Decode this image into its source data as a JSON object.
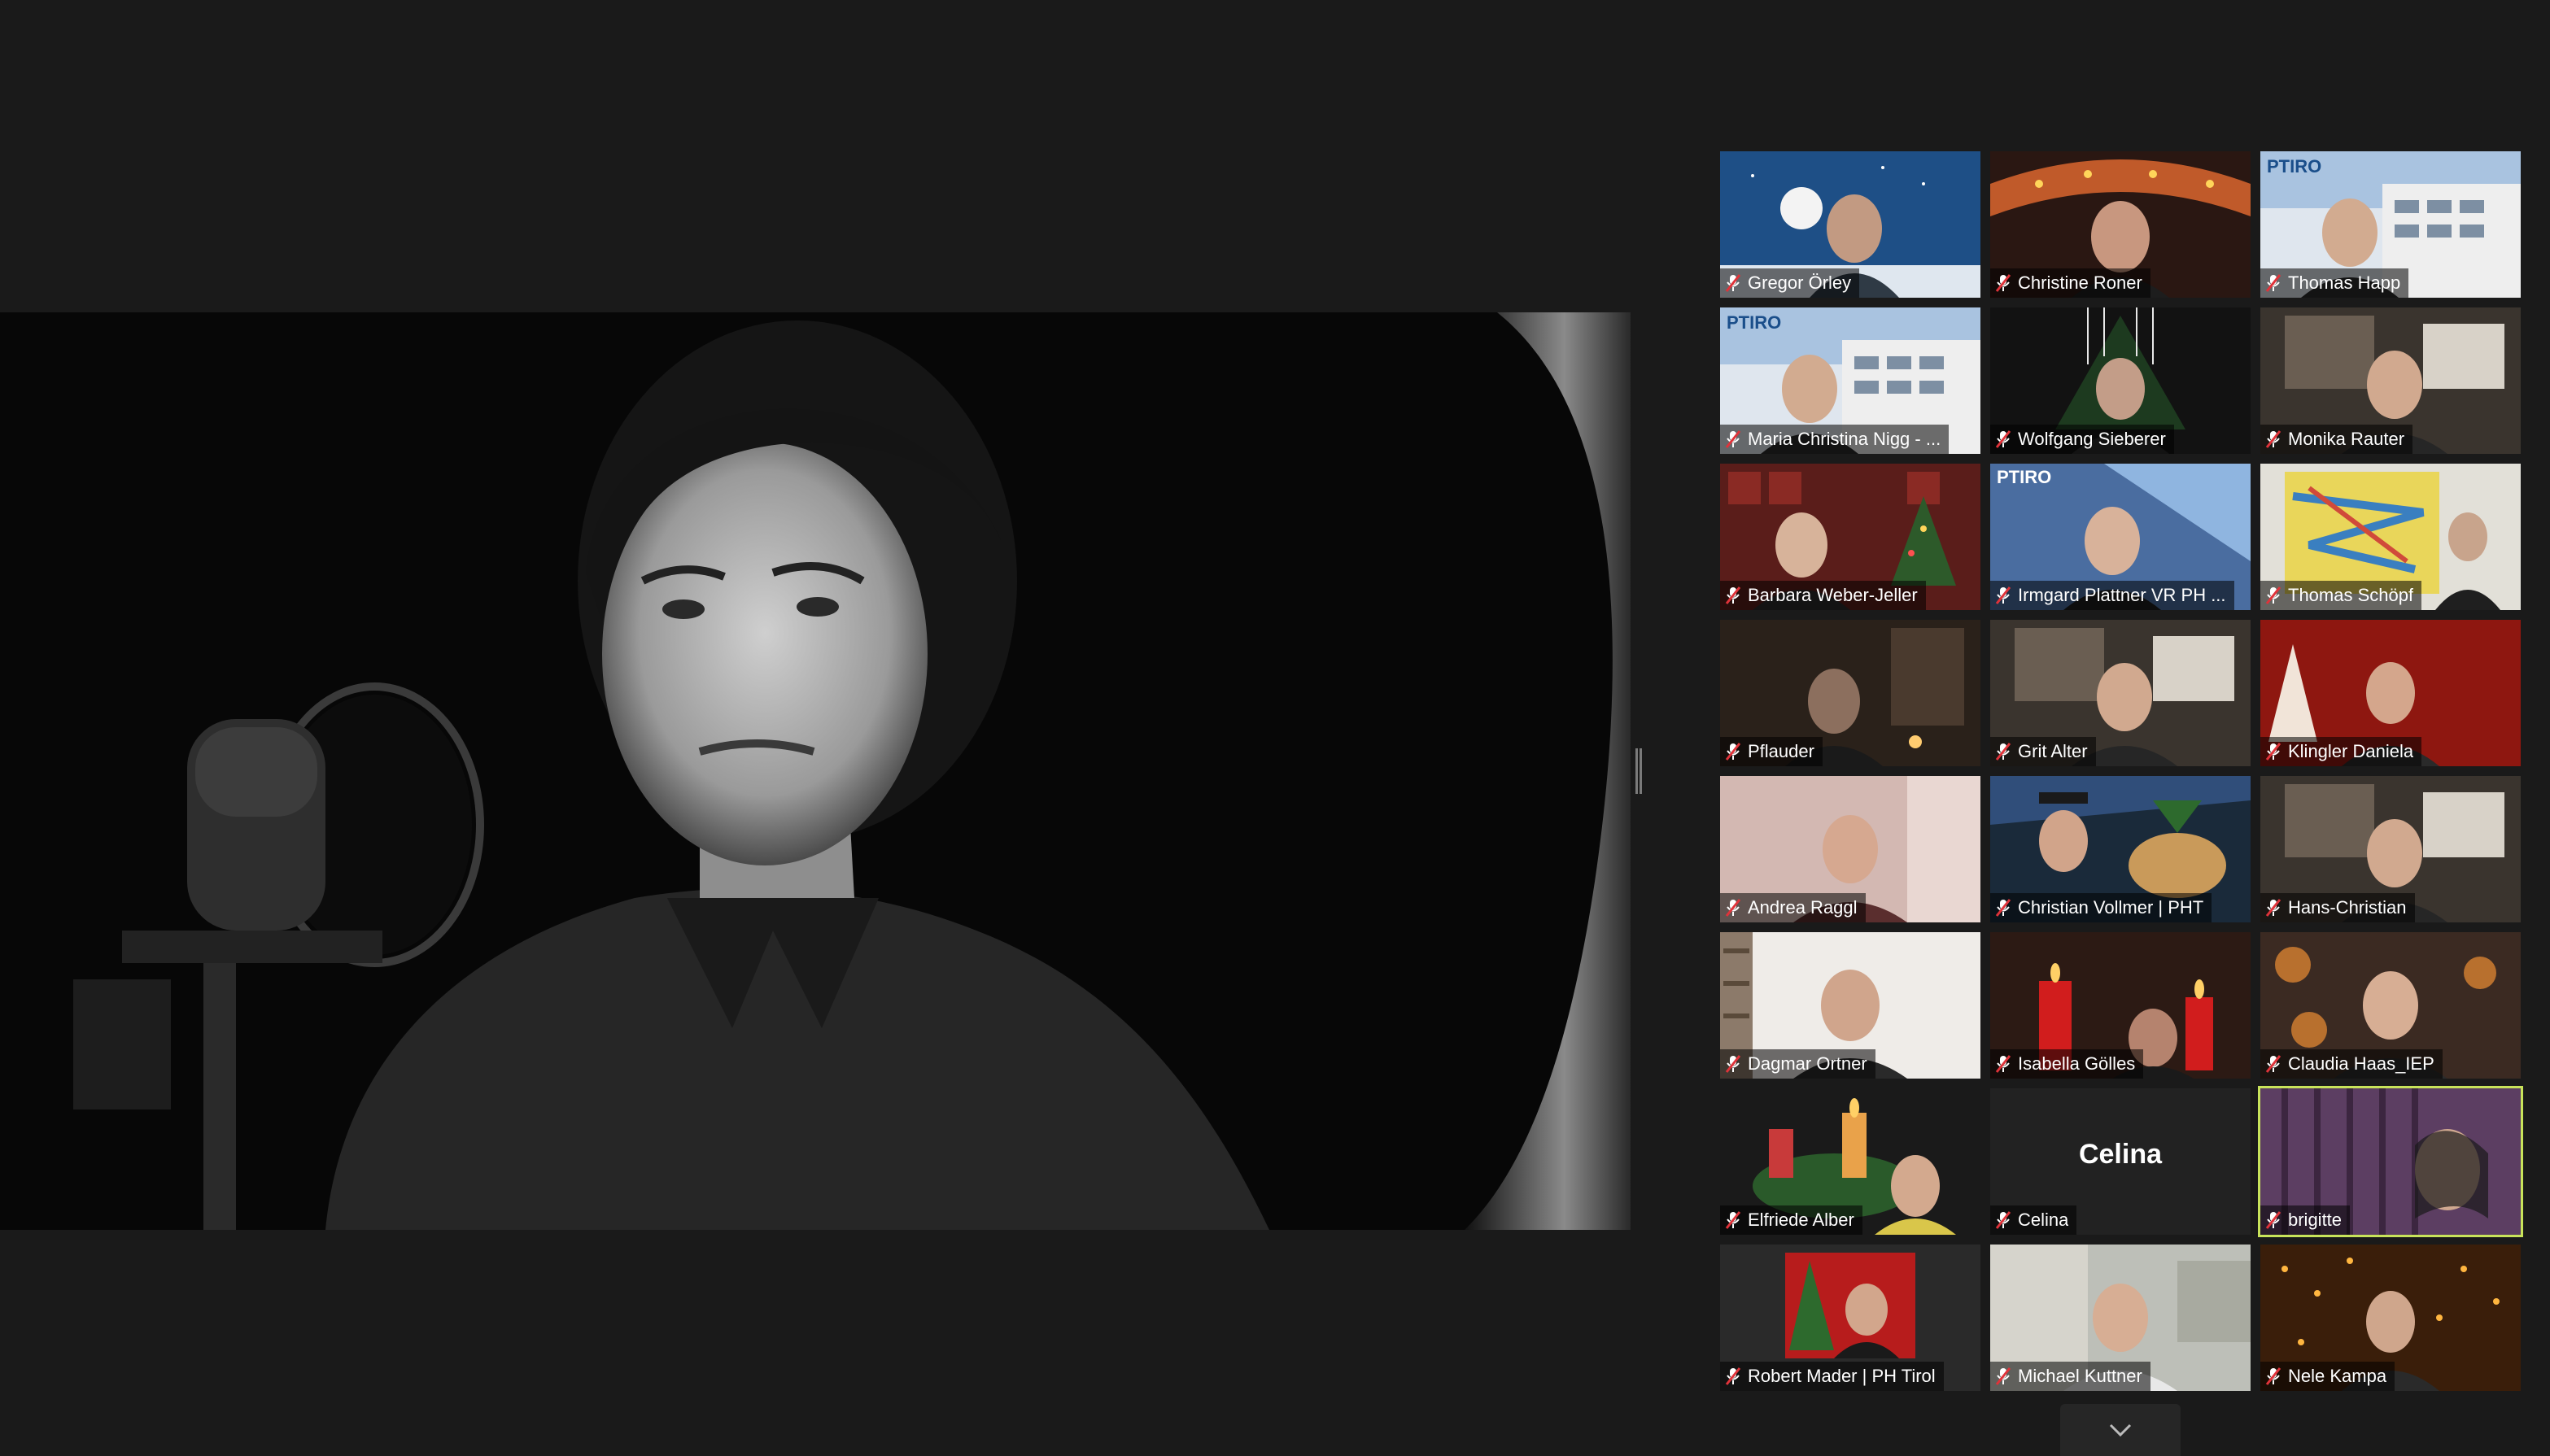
{
  "window": {
    "app": "Zoom Meeting",
    "accent_active_speaker": "#c8e35a",
    "muted_color": "#e0333a"
  },
  "main": {
    "shared_video_description_icon": "shared-video-icon"
  },
  "participants": [
    {
      "name": "Gregor Örley",
      "muted": true,
      "scene": "night-sky"
    },
    {
      "name": "Christine Roner",
      "muted": true,
      "scene": "carousel"
    },
    {
      "name": "Thomas Happ",
      "muted": true,
      "scene": "pht-building"
    },
    {
      "name": "Maria Christina Nigg  - ...",
      "muted": true,
      "scene": "pht-building"
    },
    {
      "name": "Wolfgang Sieberer",
      "muted": true,
      "scene": "christmas-tree"
    },
    {
      "name": "Monika Rauter",
      "muted": true,
      "scene": "room"
    },
    {
      "name": "Barbara Weber-Jeller",
      "muted": true,
      "scene": "christmas-room"
    },
    {
      "name": "Irmgard Plattner VR PH ...",
      "muted": true,
      "scene": "pht-sky"
    },
    {
      "name": "Thomas Schöpf",
      "muted": true,
      "scene": "painting"
    },
    {
      "name": "Pflauder",
      "muted": true,
      "scene": "dark-room"
    },
    {
      "name": "Grit Alter",
      "muted": true,
      "scene": "room"
    },
    {
      "name": "Klingler Daniela",
      "muted": true,
      "scene": "red"
    },
    {
      "name": "Andrea Raggl",
      "muted": true,
      "scene": "pink-room"
    },
    {
      "name": "Christian Vollmer | PHT",
      "muted": true,
      "scene": "dog"
    },
    {
      "name": "Hans-Christian",
      "muted": true,
      "scene": "room"
    },
    {
      "name": "Dagmar Ortner",
      "muted": true,
      "scene": "bookshelf"
    },
    {
      "name": "Isabella Gölles",
      "muted": true,
      "scene": "candles"
    },
    {
      "name": "Claudia Haas_IEP",
      "muted": true,
      "scene": "gingerbread"
    },
    {
      "name": "Elfriede Alber",
      "muted": true,
      "scene": "advent-wreath"
    },
    {
      "name": "Celina",
      "muted": true,
      "scene": "blank",
      "display_name": "Celina"
    },
    {
      "name": "brigitte",
      "muted": true,
      "scene": "curtain",
      "active": true
    },
    {
      "name": "Robert Mader | PH Tirol",
      "muted": true,
      "scene": "xmas-photo"
    },
    {
      "name": "Michael Kuttner",
      "muted": true,
      "scene": "blur"
    },
    {
      "name": "Nele Kampa",
      "muted": true,
      "scene": "lights"
    }
  ],
  "controls": {
    "more_icon": "chevron-down-icon"
  }
}
